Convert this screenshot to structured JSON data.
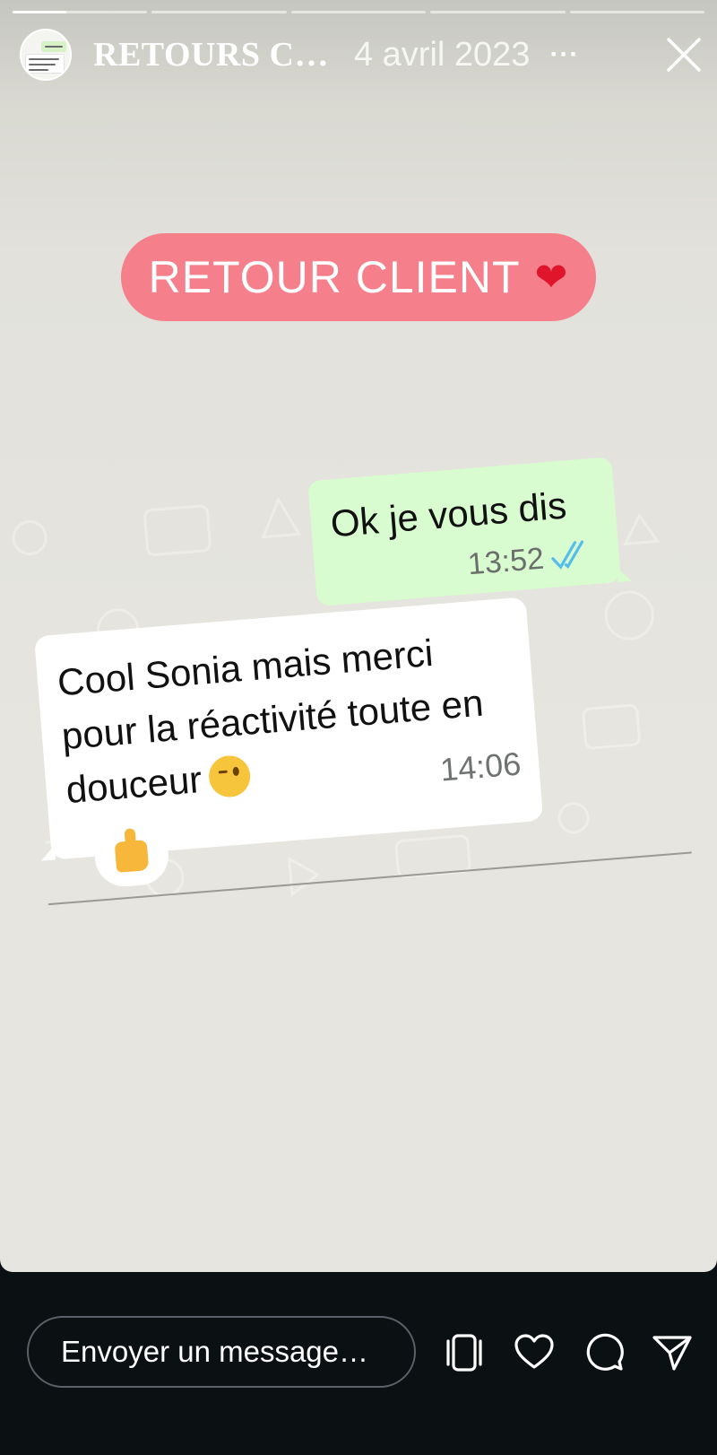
{
  "story": {
    "segments": [
      {
        "progress": 0.4
      },
      {
        "progress": 0
      },
      {
        "progress": 0
      },
      {
        "progress": 0
      },
      {
        "progress": 0
      }
    ],
    "account_title": "RETOURS C…",
    "date": "4 avril 2023",
    "more_label": "···",
    "avatar_preview_text": "Ok je vous dis"
  },
  "sticker": {
    "label": "RETOUR CLIENT",
    "heart": "❤"
  },
  "chat": {
    "outgoing": {
      "text": "Ok je vous dis",
      "time": "13:52",
      "status_icon": "double-check-icon",
      "status_color": "#53bdeb"
    },
    "incoming": {
      "text": "Cool Sonia mais merci pour la réactivité toute en douceur",
      "emoji": "wink-emoji-icon",
      "time": "14:06"
    },
    "reaction": "thumbs-up-icon"
  },
  "bottom_bar": {
    "message_placeholder": "Envoyer un message…",
    "icons": [
      "stack-icon",
      "heart-icon",
      "comment-icon",
      "share-icon"
    ]
  },
  "colors": {
    "pill": "#f57f8b",
    "outgoing_bubble": "#d9fbd0",
    "incoming_bubble": "#ffffff",
    "bottom_bar": "#0b1013"
  }
}
